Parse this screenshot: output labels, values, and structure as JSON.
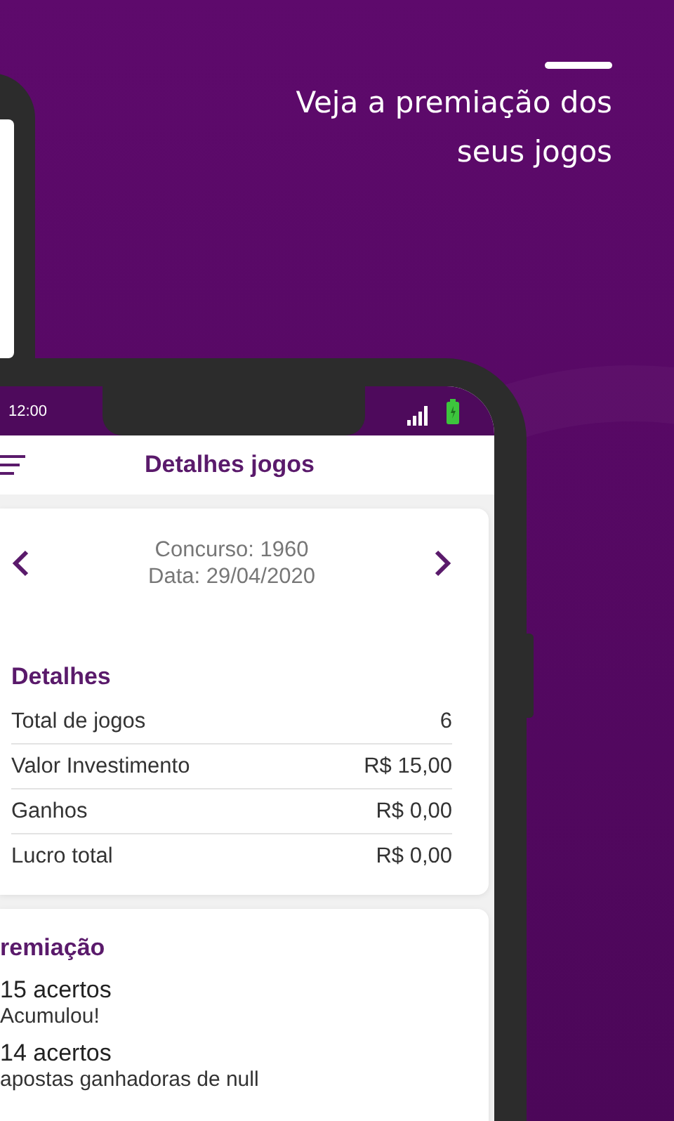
{
  "headline": {
    "text": "Veja a premiação dos\nseus jogos"
  },
  "status_bar": {
    "time": "12:00"
  },
  "app_bar": {
    "title": "Detalhes jogos"
  },
  "draw": {
    "contest": "Concurso: 1960",
    "date": "Data: 29/04/2020"
  },
  "details": {
    "title": "Detalhes",
    "rows": [
      {
        "label": "Total de jogos",
        "value": "6"
      },
      {
        "label": "Valor Investimento",
        "value": "R$ 15,00"
      },
      {
        "label": "Ganhos",
        "value": "R$ 0,00"
      },
      {
        "label": "Lucro total",
        "value": "R$ 0,00"
      }
    ]
  },
  "prizes": {
    "title": "remiação",
    "items": [
      {
        "title": "15 acertos",
        "description": "Acumulou!"
      },
      {
        "title": "14 acertos",
        "description": "apostas ganhadoras de null"
      }
    ]
  }
}
